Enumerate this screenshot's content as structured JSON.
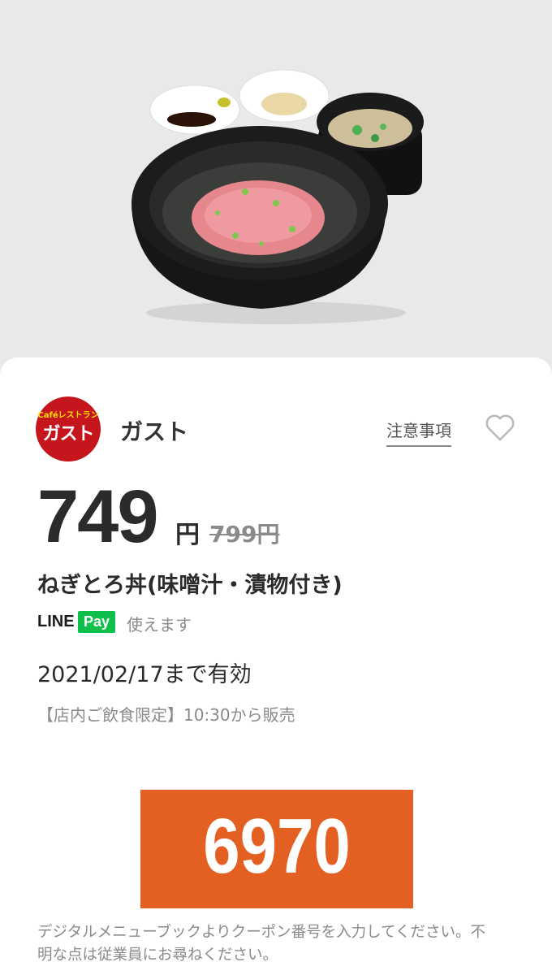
{
  "shop": {
    "logo_top": "Caféレストラン",
    "logo_main": "ガスト",
    "name": "ガスト"
  },
  "header": {
    "notes_label": "注意事項",
    "favorite_icon": "heart-outline-icon"
  },
  "coupon": {
    "price": "749",
    "price_unit": "円",
    "original_price": "799円",
    "item_name": "ねぎとろ丼(味噌汁・漬物付き)",
    "payment": {
      "line": "LINE",
      "pay": "Pay",
      "usable_text": "使えます"
    },
    "valid_until": "2021/02/17まで有効",
    "restriction": "【店内ご飲食限定】10:30から販売",
    "code": "6970",
    "note": "デジタルメニューブックよりクーポン番号を入力してください。不明な点は従業員にお尋ねください。"
  },
  "colors": {
    "brand_red": "#c4161c",
    "code_orange": "#e45f22",
    "line_green": "#0ec04b"
  }
}
